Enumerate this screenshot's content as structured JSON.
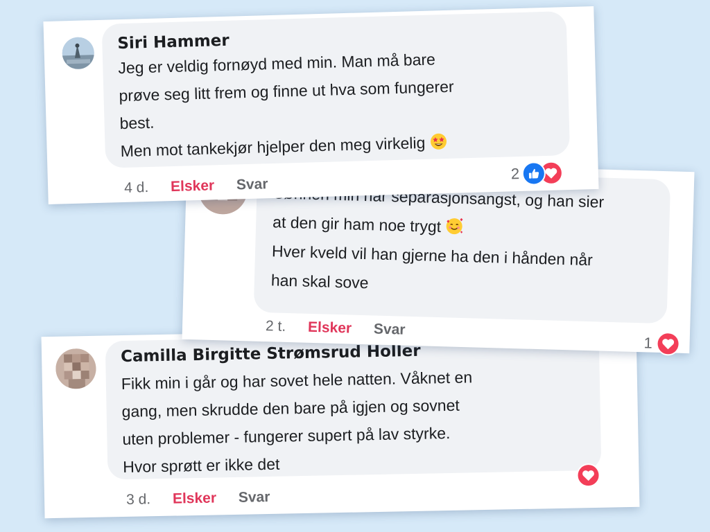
{
  "comments": [
    {
      "author": "Siri Hammer",
      "lines": [
        "Jeg er veldig fornøyd med min. Man må bare",
        "prøve seg litt frem og finne ut hva som fungerer",
        "best.",
        "Men mot tankekjør hjelper den meg virkelig"
      ],
      "emoji": "star-struck-emoji",
      "time": "4 d.",
      "react_label": "Elsker",
      "reply_label": "Svar",
      "reaction_count": "2",
      "reactions": [
        "like-icon",
        "love-icon"
      ]
    },
    {
      "author": "",
      "lines": [
        "Sønnen min har separasjonsangst, og han sier",
        "at den gir ham noe trygt",
        "Hver kveld vil han gjerne ha den i hånden når",
        "han skal sove"
      ],
      "emoji": "smiling-face-with-hearts-emoji",
      "time": "2 t.",
      "react_label": "Elsker",
      "reply_label": "Svar",
      "reaction_count": "1",
      "reactions": [
        "love-icon"
      ]
    },
    {
      "author": "Camilla Birgitte Strømsrud Holler",
      "lines": [
        "Fikk min i går og har sovet hele natten. Våknet en",
        "gang, men skrudde den bare på igjen og sovnet",
        "uten problemer - fungerer supert på lav styrke.",
        "Hvor sprøtt er ikke det"
      ],
      "emoji": "",
      "time": "3 d.",
      "react_label": "Elsker",
      "reply_label": "Svar",
      "reaction_count": "",
      "reactions": [
        "love-icon"
      ]
    }
  ],
  "colors": {
    "background": "#d6e9f8",
    "bubble": "#f0f2f5",
    "react_link": "#e0365a",
    "like_blue": "#1877f2",
    "love_red": "#f33e58",
    "muted_text": "#65676b"
  }
}
